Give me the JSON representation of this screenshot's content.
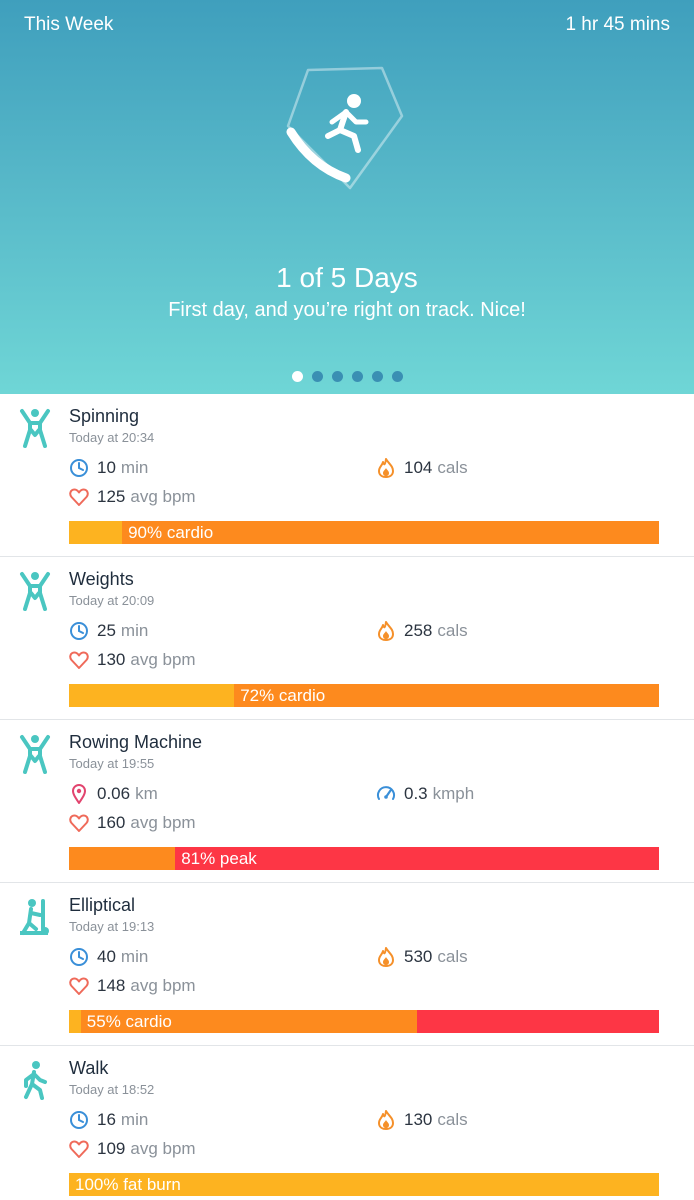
{
  "header": {
    "left_title": "This Week",
    "right_total": "1 hr 45 mins",
    "badge_icon": "running-person-shield-icon",
    "headline": "1 of 5 Days",
    "subtitle": "First day, and you’re right on track. Nice!",
    "page_count": 6,
    "active_page": 1
  },
  "colors": {
    "fat_burn": "#fdb320",
    "cardio": "#fd8a1e",
    "peak": "#fd3645",
    "icon_teal": "#4ac6c1",
    "clock_blue": "#3a8fd8",
    "flame_orange": "#f5902a",
    "heart_red": "#ef6a5a",
    "pin_pink": "#e2446e"
  },
  "activities": [
    {
      "name": "Spinning",
      "time": "Today at 20:34",
      "icon": "arms-up-person-icon",
      "stat1": {
        "icon": "clock-icon",
        "value": "10",
        "unit": "min"
      },
      "stat2": {
        "icon": "flame-icon",
        "value": "104",
        "unit": "cals"
      },
      "stat3": {
        "icon": "heart-icon",
        "value": "125",
        "unit": "avg bpm"
      },
      "zones": [
        {
          "zone": "fat_burn",
          "fraction": 0.09
        },
        {
          "zone": "cardio",
          "fraction": 0.91
        }
      ],
      "zone_label": "90% cardio",
      "label_zone_index": 1
    },
    {
      "name": "Weights",
      "time": "Today at 20:09",
      "icon": "arms-up-person-icon",
      "stat1": {
        "icon": "clock-icon",
        "value": "25",
        "unit": "min"
      },
      "stat2": {
        "icon": "flame-icon",
        "value": "258",
        "unit": "cals"
      },
      "stat3": {
        "icon": "heart-icon",
        "value": "130",
        "unit": "avg bpm"
      },
      "zones": [
        {
          "zone": "fat_burn",
          "fraction": 0.28
        },
        {
          "zone": "cardio",
          "fraction": 0.72
        }
      ],
      "zone_label": "72% cardio",
      "label_zone_index": 1
    },
    {
      "name": "Rowing Machine",
      "time": "Today at 19:55",
      "icon": "arms-up-person-icon",
      "stat1": {
        "icon": "location-pin-icon",
        "value": "0.06",
        "unit": "km"
      },
      "stat2": {
        "icon": "speedometer-icon",
        "value": "0.3",
        "unit": "kmph"
      },
      "stat3": {
        "icon": "heart-icon",
        "value": "160",
        "unit": "avg bpm"
      },
      "zones": [
        {
          "zone": "cardio",
          "fraction": 0.18
        },
        {
          "zone": "peak",
          "fraction": 0.82
        }
      ],
      "zone_label": "81% peak",
      "label_zone_index": 1
    },
    {
      "name": "Elliptical",
      "time": "Today at 19:13",
      "icon": "elliptical-machine-icon",
      "stat1": {
        "icon": "clock-icon",
        "value": "40",
        "unit": "min"
      },
      "stat2": {
        "icon": "flame-icon",
        "value": "530",
        "unit": "cals"
      },
      "stat3": {
        "icon": "heart-icon",
        "value": "148",
        "unit": "avg bpm"
      },
      "zones": [
        {
          "zone": "fat_burn",
          "fraction": 0.02
        },
        {
          "zone": "cardio",
          "fraction": 0.57
        },
        {
          "zone": "peak",
          "fraction": 0.41
        }
      ],
      "zone_label": "55% cardio",
      "label_zone_index": 1
    },
    {
      "name": "Walk",
      "time": "Today at 18:52",
      "icon": "walking-person-icon",
      "stat1": {
        "icon": "clock-icon",
        "value": "16",
        "unit": "min"
      },
      "stat2": {
        "icon": "flame-icon",
        "value": "130",
        "unit": "cals"
      },
      "stat3": {
        "icon": "heart-icon",
        "value": "109",
        "unit": "avg bpm"
      },
      "zones": [
        {
          "zone": "fat_burn",
          "fraction": 1.0
        }
      ],
      "zone_label": "100% fat burn",
      "label_zone_index": 0
    }
  ]
}
